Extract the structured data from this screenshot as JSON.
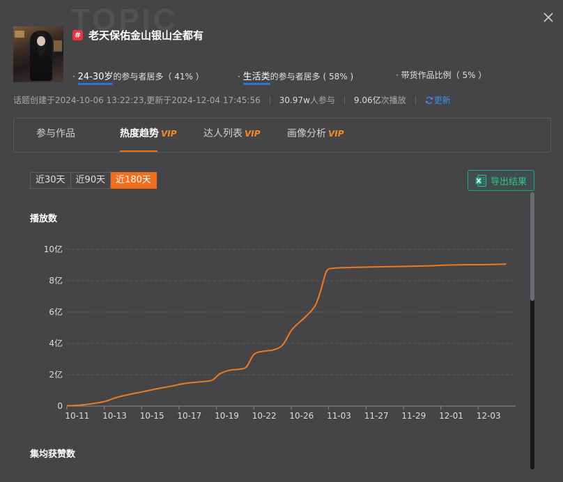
{
  "header": {
    "watermark": "TOPIC",
    "hash_glyph": "#",
    "title": "老天保佑金山银山全都有",
    "stats": [
      {
        "prefix": "· ",
        "highlight": "24-30岁",
        "suffix": "的参与者居多（ 41% ）"
      },
      {
        "prefix": "· ",
        "highlight": "生活类",
        "suffix": "的参与者居多 ( 58% )"
      },
      {
        "prefix": "· ",
        "highlight": "",
        "suffix": "带货作品比例（ 5% ）"
      }
    ],
    "meta": {
      "created": "话题创建于2024-10-06 13:22:23,更新于2024-12-04 17:45:56",
      "participants_value": "30.97w",
      "participants_suffix": "人参与",
      "plays_value": "9.06亿",
      "plays_suffix": "次播放",
      "refresh_label": "更新"
    }
  },
  "tabs": [
    {
      "label": "参与作品",
      "vip": ""
    },
    {
      "label": "热度趋势",
      "vip": "VIP"
    },
    {
      "label": "达人列表",
      "vip": "VIP"
    },
    {
      "label": "画像分析",
      "vip": "VIP"
    }
  ],
  "range_buttons": [
    "近30天",
    "近90天",
    "近180天"
  ],
  "export_label": "导出结果",
  "sections": {
    "plays_title": "播放数",
    "likes_title": "集均获赞数"
  },
  "colors": {
    "accent": "#f06e1e",
    "link": "#3d8ef0",
    "export": "#2fc58f",
    "line": "#f07a1e"
  },
  "chart_data": {
    "type": "line",
    "ylabel": "",
    "ylim": [
      0,
      10
    ],
    "y_ticks": [
      0,
      2,
      4,
      6,
      8,
      10
    ],
    "y_tick_labels": [
      "0",
      "2亿",
      "4亿",
      "6亿",
      "8亿",
      "10亿"
    ],
    "x_tick_labels": [
      "10-11",
      "10-13",
      "10-15",
      "10-17",
      "10-19",
      "10-22",
      "10-26",
      "11-03",
      "11-27",
      "11-29",
      "12-01",
      "12-03"
    ],
    "x_range": [
      0,
      23.5
    ],
    "grid": true,
    "series": [
      {
        "name": "",
        "points": [
          [
            0,
            0.02
          ],
          [
            0.6,
            0.05
          ],
          [
            1.3,
            0.15
          ],
          [
            2,
            0.3
          ],
          [
            2.6,
            0.55
          ],
          [
            3.3,
            0.75
          ],
          [
            4,
            0.92
          ],
          [
            4.7,
            1.1
          ],
          [
            5.5,
            1.28
          ],
          [
            6.2,
            1.45
          ],
          [
            7,
            1.55
          ],
          [
            7.6,
            1.65
          ],
          [
            8,
            2.05
          ],
          [
            8.5,
            2.28
          ],
          [
            9,
            2.35
          ],
          [
            9.4,
            2.5
          ],
          [
            9.8,
            3.3
          ],
          [
            10.3,
            3.5
          ],
          [
            10.8,
            3.58
          ],
          [
            11.3,
            3.9
          ],
          [
            11.8,
            4.9
          ],
          [
            12.5,
            5.7
          ],
          [
            13,
            6.4
          ],
          [
            13.3,
            7.4
          ],
          [
            13.6,
            8.6
          ],
          [
            14,
            8.8
          ],
          [
            15,
            8.85
          ],
          [
            16,
            8.88
          ],
          [
            17,
            8.9
          ],
          [
            18,
            8.92
          ],
          [
            19,
            8.95
          ],
          [
            20,
            9.0
          ],
          [
            21,
            9.02
          ],
          [
            22,
            9.03
          ],
          [
            23,
            9.06
          ]
        ]
      }
    ]
  }
}
